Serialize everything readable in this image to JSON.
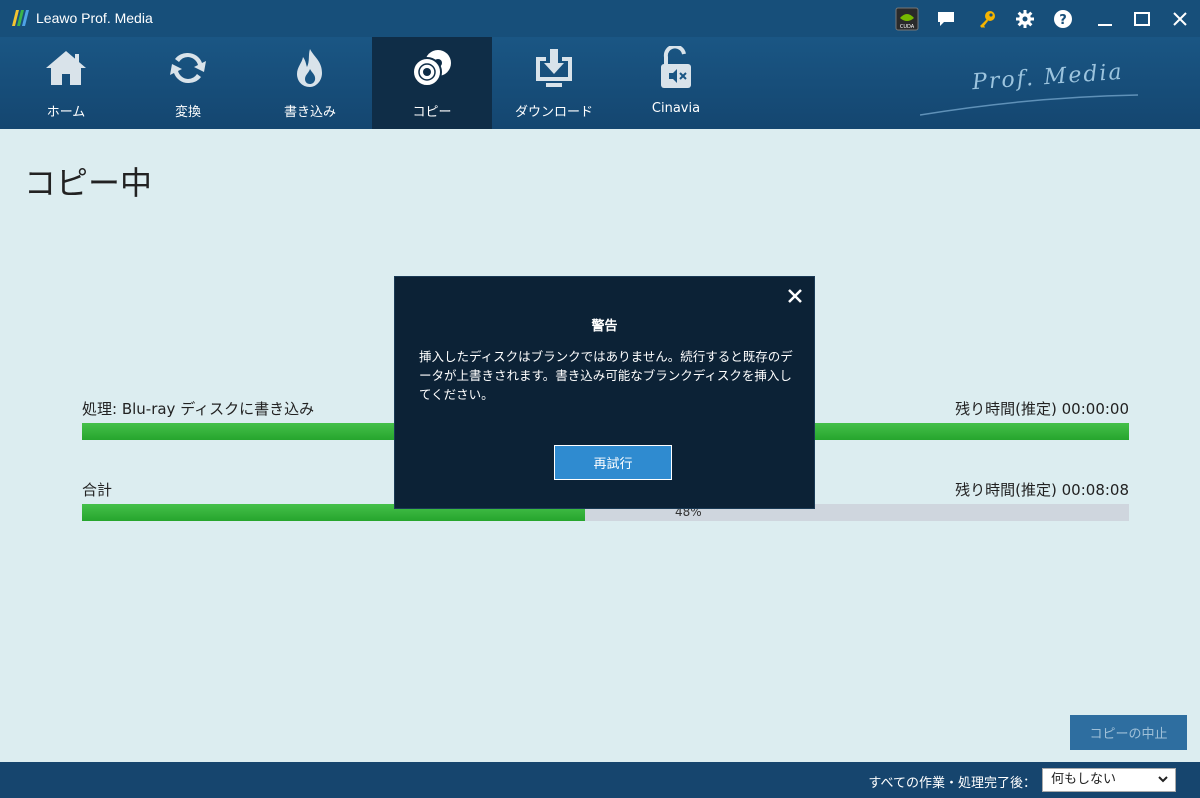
{
  "titlebar": {
    "title": "Leawo Prof. Media",
    "cuda_label": "CUDA"
  },
  "nav": {
    "items": [
      {
        "label": "ホーム",
        "icon": "home-icon"
      },
      {
        "label": "変換",
        "icon": "convert-icon"
      },
      {
        "label": "書き込み",
        "icon": "burn-icon"
      },
      {
        "label": "コピー",
        "icon": "copy-icon",
        "active": true
      },
      {
        "label": "ダウンロード",
        "icon": "download-icon"
      },
      {
        "label": "Cinavia",
        "icon": "cinavia-icon"
      }
    ],
    "brand": "Prof. Media"
  },
  "main": {
    "title": "コピー中",
    "process_label": "処理: Blu-ray ディスクに書き込み",
    "process_remaining": "残り時間(推定) 00:00:00",
    "process_progress": 1.0,
    "total_label": "合計",
    "total_remaining": "残り時間(推定) 00:08:08",
    "total_progress": 0.48,
    "total_percent_text": "48%",
    "stop_button": "コピーの中止"
  },
  "bottombar": {
    "after_label": "すべての作業・処理完了後：",
    "after_value": "何もしない"
  },
  "dialog": {
    "title": "警告",
    "message": "挿入したディスクはブランクではありません。続行すると既存のデータが上書きされます。書き込み可能なブランクディスクを挿入してください。",
    "retry_button": "再試行"
  },
  "colors": {
    "titlebar": "#174f7a",
    "active_tab": "#0f2d47",
    "progress_green": "#26a52d",
    "dialog_bg": "#0c2236",
    "dialog_button": "#2f8bd0"
  }
}
